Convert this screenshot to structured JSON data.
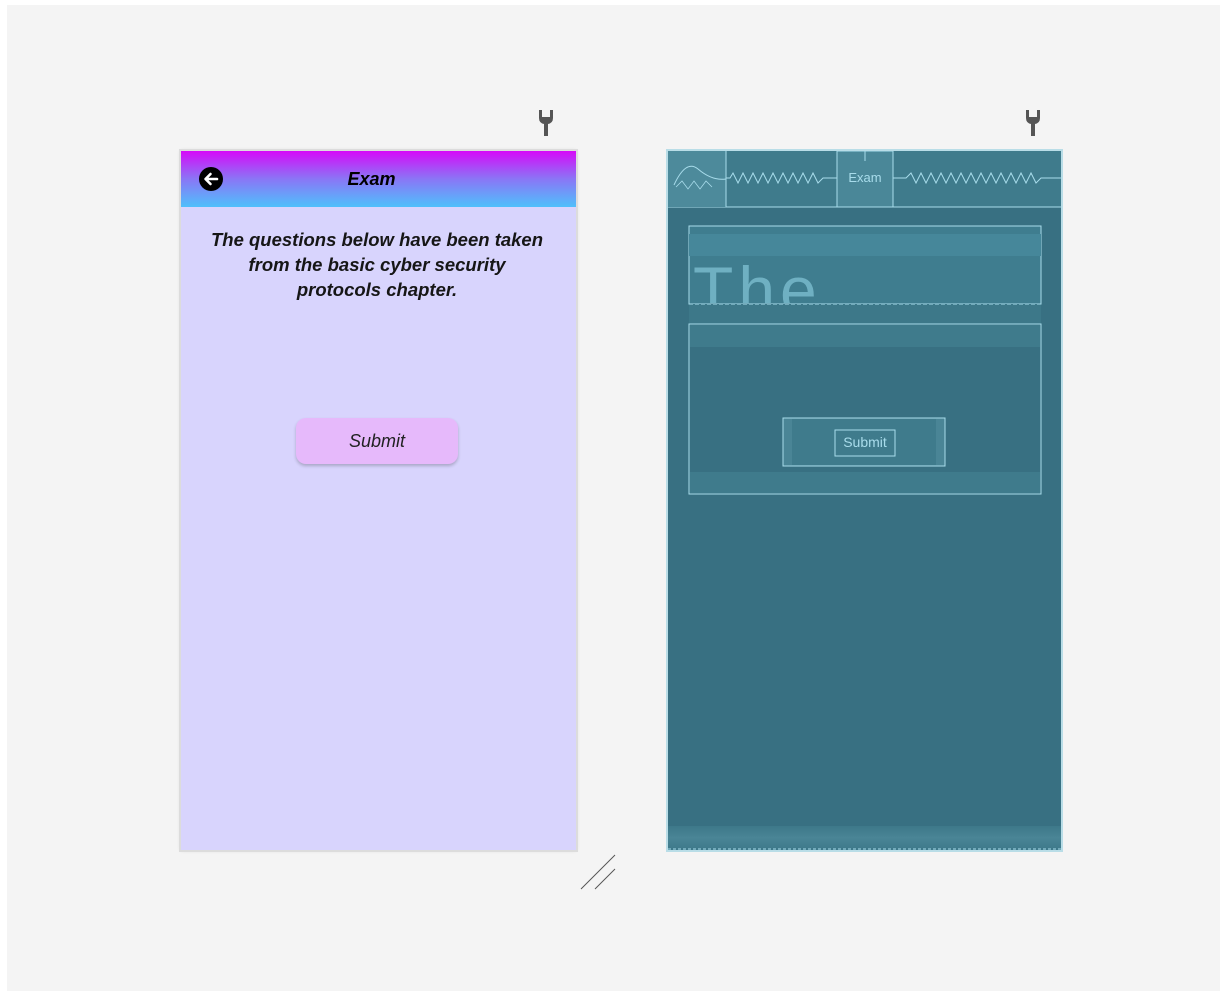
{
  "design": {
    "appbar_title": "Exam",
    "intro_text": "The questions below have been taken from the basic cyber security protocols chapter.",
    "submit_label": "Submit",
    "icons": {
      "back": "arrow-back-circle-icon"
    },
    "colors": {
      "background": "#d8d4fd",
      "appbar_gradient_top": "#d60af8",
      "appbar_gradient_bottom": "#4fc0fb",
      "button": "#e6b9fb"
    }
  },
  "blueprint": {
    "appbar_title": "Exam",
    "big_text_fragment": "The",
    "submit_label": "Submit",
    "colors": {
      "background": "#387082",
      "outline": "#a8dceb"
    }
  },
  "toolbar": {
    "icons": {
      "pin": "pin-icon",
      "resize": "resize-handle-icon"
    }
  }
}
